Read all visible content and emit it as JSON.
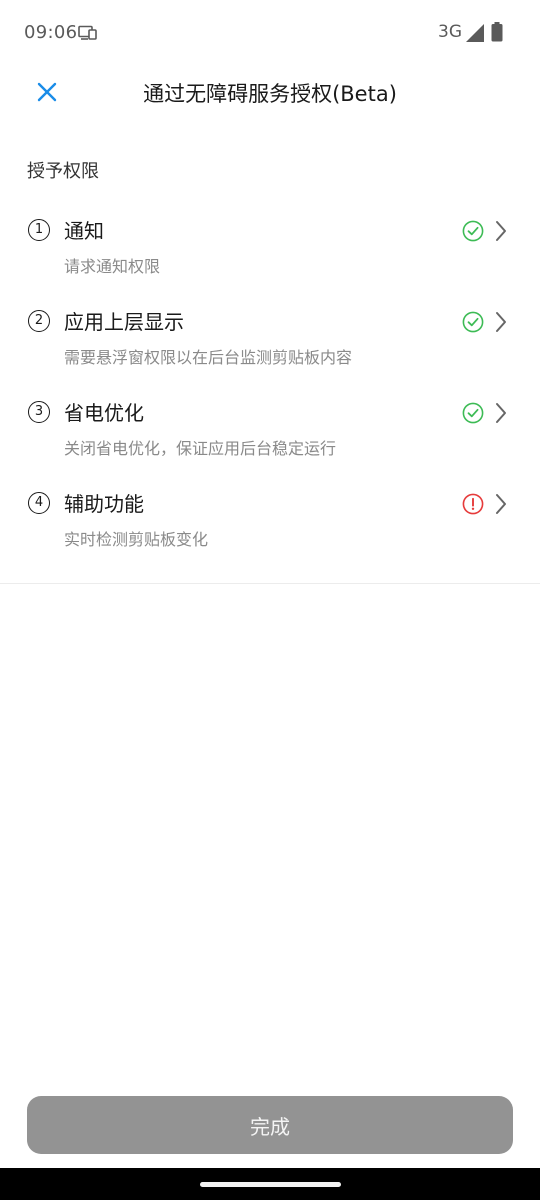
{
  "status_bar": {
    "time": "09:06",
    "network": "3G",
    "icons": [
      "cast-icon",
      "signal-icon",
      "battery-icon"
    ]
  },
  "header": {
    "title": "通过无障碍服务授权(Beta)",
    "close_icon": "close-icon"
  },
  "section": {
    "label": "授予权限"
  },
  "permissions": [
    {
      "num": "1",
      "title": "通知",
      "desc": "请求通知权限",
      "status": "granted"
    },
    {
      "num": "2",
      "title": "应用上层显示",
      "desc": "需要悬浮窗权限以在后台监测剪贴板内容",
      "status": "granted"
    },
    {
      "num": "3",
      "title": "省电优化",
      "desc": "关闭省电优化，保证应用后台稳定运行",
      "status": "granted"
    },
    {
      "num": "4",
      "title": "辅助功能",
      "desc": "实时检测剪贴板变化",
      "status": "missing"
    }
  ],
  "footer": {
    "done_label": "完成"
  },
  "colors": {
    "accent": "#1a8ce8",
    "granted": "#3dbb55",
    "missing": "#e63b3b",
    "button_disabled": "#939393"
  }
}
